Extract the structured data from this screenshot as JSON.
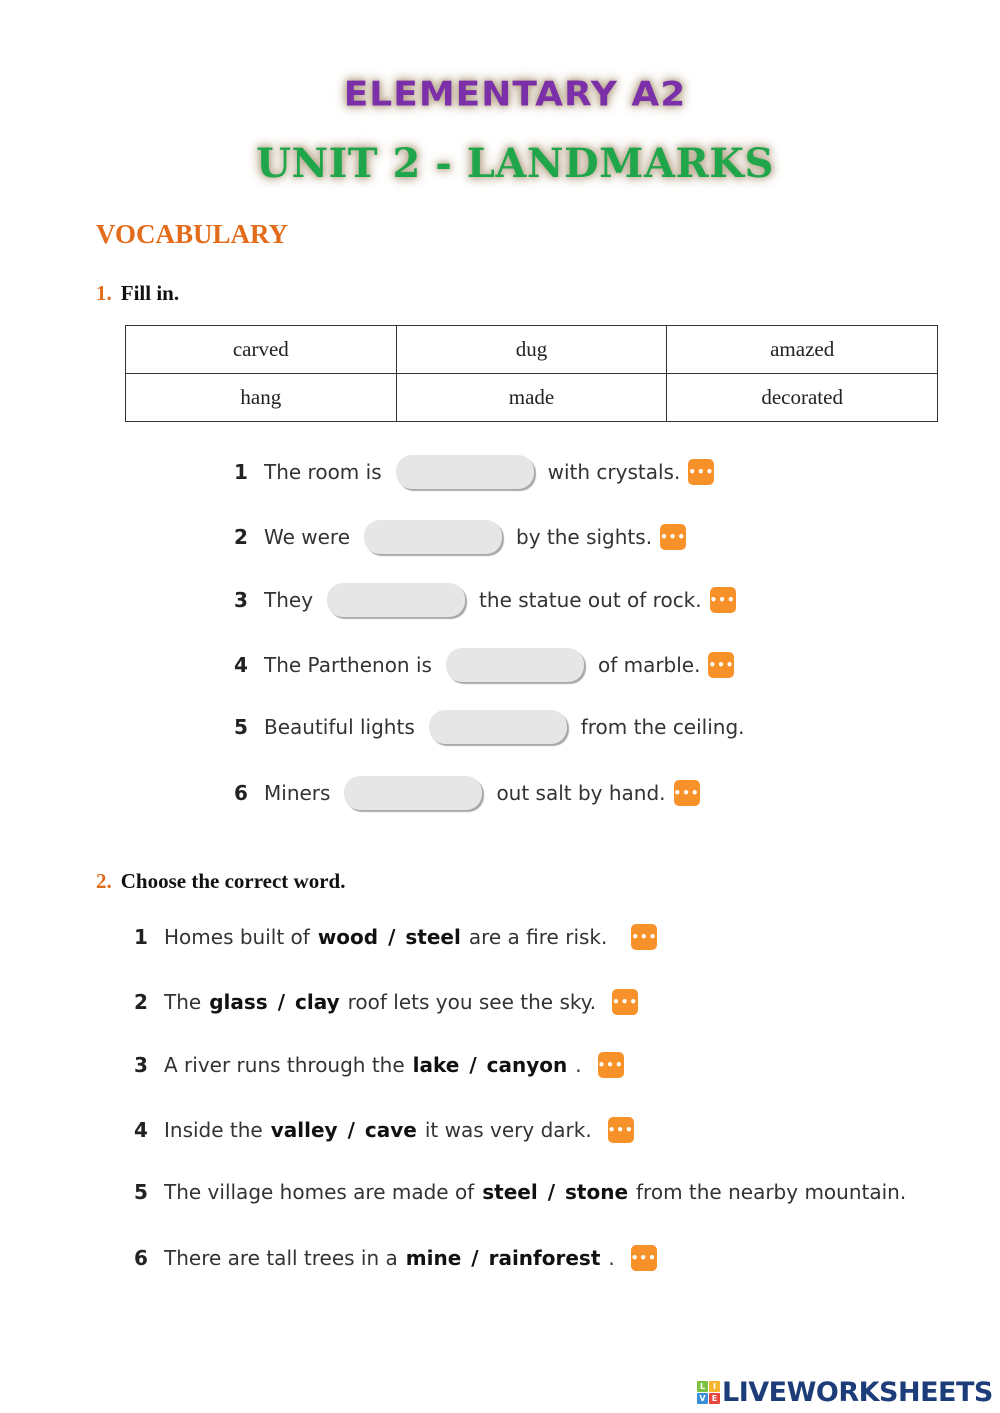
{
  "header": {
    "level": "ELEMENTARY A2",
    "unit": "UNIT 2 - LANDMARKS"
  },
  "section_title": "VOCABULARY",
  "exercise1": {
    "number": "1.",
    "instruction": "Fill in.",
    "word_bank": [
      [
        "carved",
        "dug",
        "amazed"
      ],
      [
        "hang",
        "made",
        "decorated"
      ]
    ],
    "items": [
      {
        "n": "1",
        "before": "The room is",
        "after": "with crystals.",
        "value": "",
        "has_menu": true
      },
      {
        "n": "2",
        "before": "We were",
        "after": "by the sights.",
        "value": "",
        "has_menu": true
      },
      {
        "n": "3",
        "before": "They",
        "after": "the statue out of rock.",
        "value": "",
        "has_menu": true
      },
      {
        "n": "4",
        "before": "The Parthenon is",
        "after": "of marble.",
        "value": "",
        "has_menu": true
      },
      {
        "n": "5",
        "before": "Beautiful lights",
        "after": "from the ceiling.",
        "value": "",
        "has_menu": false
      },
      {
        "n": "6",
        "before": "Miners",
        "after": "out salt by hand.",
        "value": "",
        "has_menu": true
      }
    ]
  },
  "exercise2": {
    "number": "2.",
    "instruction": "Choose the correct word.",
    "items": [
      {
        "n": "1",
        "before": "Homes built of",
        "opt1": "wood",
        "opt2": "steel",
        "after": "are a fire risk.",
        "has_menu": true
      },
      {
        "n": "2",
        "before": "The",
        "opt1": "glass",
        "opt2": "clay",
        "after": "roof lets you see the sky.",
        "has_menu": true
      },
      {
        "n": "3",
        "before": "A river runs through the",
        "opt1": "lake",
        "opt2": "canyon",
        "after": ".",
        "has_menu": true
      },
      {
        "n": "4",
        "before": "Inside the",
        "opt1": "valley",
        "opt2": "cave",
        "after": "it was very dark.",
        "has_menu": true
      },
      {
        "n": "5",
        "before": "The village homes are made of",
        "opt1": "steel",
        "opt2": "stone",
        "after": "from the nearby mountain.",
        "has_menu": false
      },
      {
        "n": "6",
        "before": "There are tall trees in a",
        "opt1": "mine",
        "opt2": "rainforest",
        "after": ".",
        "has_menu": true
      }
    ],
    "separator": "/"
  },
  "menu_icon_glyph": "•••",
  "footer": {
    "logo_letters": [
      "L",
      "I",
      "V",
      "E"
    ],
    "logo_colors": [
      "#7cc242",
      "#f5b52e",
      "#3a8fd9",
      "#e8453c"
    ],
    "brand": "LIVEWORKSHEETS"
  }
}
